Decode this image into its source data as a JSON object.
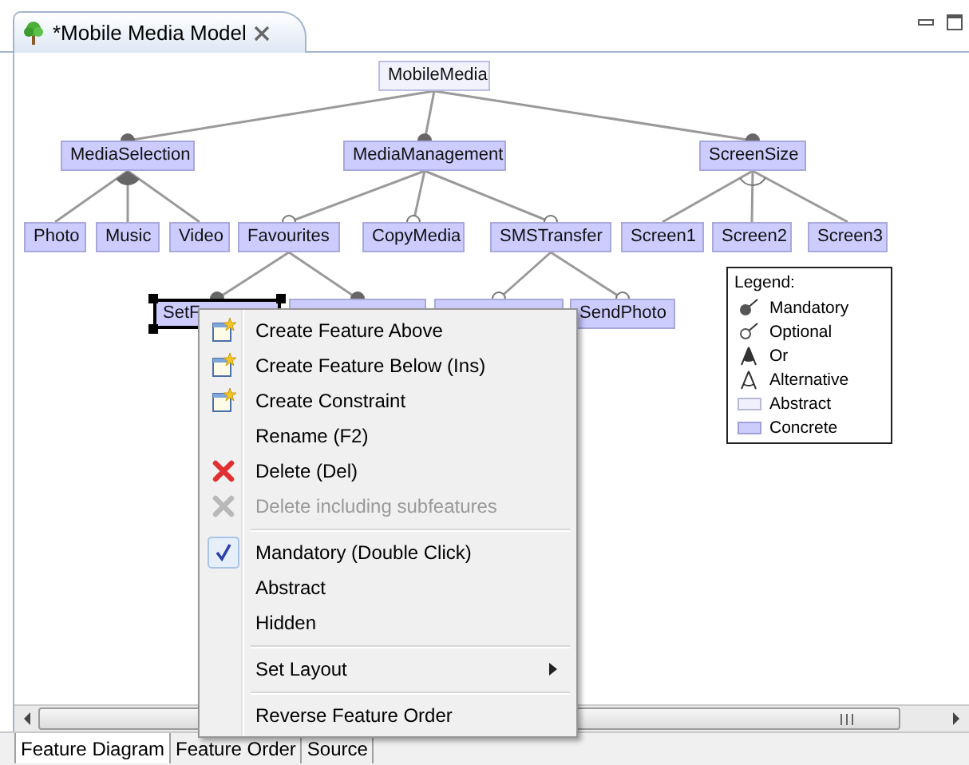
{
  "editor_tab": {
    "title": "*Mobile Media Model"
  },
  "diagram": {
    "root": {
      "name": "MobileMedia",
      "kind": "abstract",
      "selected": false,
      "group": {
        "kind": "and",
        "children": [
          {
            "name": "MediaSelection",
            "kind": "concrete",
            "selected": false,
            "mandatory": true,
            "group": {
              "kind": "or",
              "children": [
                {
                  "name": "Photo",
                  "kind": "concrete",
                  "selected": false
                },
                {
                  "name": "Music",
                  "kind": "concrete",
                  "selected": false
                },
                {
                  "name": "Video",
                  "kind": "concrete",
                  "selected": false
                }
              ]
            }
          },
          {
            "name": "MediaManagement",
            "kind": "concrete",
            "selected": false,
            "mandatory": true,
            "group": {
              "kind": "and",
              "children": [
                {
                  "name": "Favourites",
                  "kind": "concrete",
                  "selected": false,
                  "mandatory": false,
                  "group": {
                    "kind": "and",
                    "children": [
                      {
                        "name": "SetF",
                        "kind": "concrete",
                        "selected": true,
                        "mandatory": true
                      },
                      {
                        "kind": "concrete",
                        "selected": false,
                        "mandatory": true
                      }
                    ]
                  }
                },
                {
                  "name": "CopyMedia",
                  "kind": "concrete",
                  "selected": false,
                  "mandatory": false
                },
                {
                  "name": "SMSTransfer",
                  "kind": "concrete",
                  "selected": false,
                  "mandatory": false,
                  "group": {
                    "kind": "and",
                    "children": [
                      {
                        "kind": "concrete",
                        "selected": false,
                        "mandatory": false
                      },
                      {
                        "name": "SendPhoto",
                        "kind": "concrete",
                        "selected": false,
                        "mandatory": false
                      }
                    ]
                  }
                }
              ]
            }
          },
          {
            "name": "ScreenSize",
            "kind": "concrete",
            "selected": false,
            "mandatory": true,
            "group": {
              "kind": "alternative",
              "children": [
                {
                  "name": "Screen1",
                  "kind": "concrete",
                  "selected": false
                },
                {
                  "name": "Screen2",
                  "kind": "concrete",
                  "selected": false
                },
                {
                  "name": "Screen3",
                  "kind": "concrete",
                  "selected": false
                }
              ]
            }
          }
        ]
      }
    }
  },
  "legend": {
    "title": "Legend:",
    "entries": [
      {
        "label": "Mandatory",
        "kind": "mandatory"
      },
      {
        "label": "Optional",
        "kind": "optional"
      },
      {
        "label": "Or",
        "kind": "or"
      },
      {
        "label": "Alternative",
        "kind": "alternative"
      },
      {
        "label": "Abstract",
        "kind": "abstract"
      },
      {
        "label": "Concrete",
        "kind": "concrete"
      }
    ]
  },
  "context_menu": {
    "sections": [
      {
        "items": [
          {
            "label": "Create Feature Above",
            "kind": "create",
            "disabled": false,
            "submenu": false
          },
          {
            "label": "Create Feature Below (Ins)",
            "kind": "create",
            "disabled": false,
            "submenu": false
          },
          {
            "label": "Create Constraint",
            "kind": "create",
            "disabled": false,
            "submenu": false
          },
          {
            "label": "Rename (F2)",
            "kind": "plain",
            "disabled": false,
            "submenu": false
          },
          {
            "label": "Delete (Del)",
            "kind": "delete",
            "disabled": false,
            "submenu": false
          },
          {
            "label": "Delete including subfeatures",
            "kind": "delete",
            "disabled": true,
            "submenu": false
          }
        ]
      },
      {
        "items": [
          {
            "label": "Mandatory (Double Click)",
            "kind": "toggle",
            "checked": true,
            "disabled": false,
            "submenu": false
          },
          {
            "label": "Abstract",
            "kind": "toggle",
            "checked": false,
            "disabled": false,
            "submenu": false
          },
          {
            "label": "Hidden",
            "kind": "toggle",
            "checked": false,
            "disabled": false,
            "submenu": false
          }
        ]
      },
      {
        "items": [
          {
            "label": "Set Layout",
            "kind": "plain",
            "disabled": false,
            "submenu": true
          }
        ]
      },
      {
        "items": [
          {
            "label": "Reverse Feature Order",
            "kind": "plain",
            "disabled": false,
            "submenu": false
          }
        ]
      }
    ]
  },
  "bottom_tabs": [
    {
      "label": "Feature Diagram",
      "selected": true
    },
    {
      "label": "Feature Order",
      "selected": false
    },
    {
      "label": "Source",
      "selected": false
    }
  ]
}
